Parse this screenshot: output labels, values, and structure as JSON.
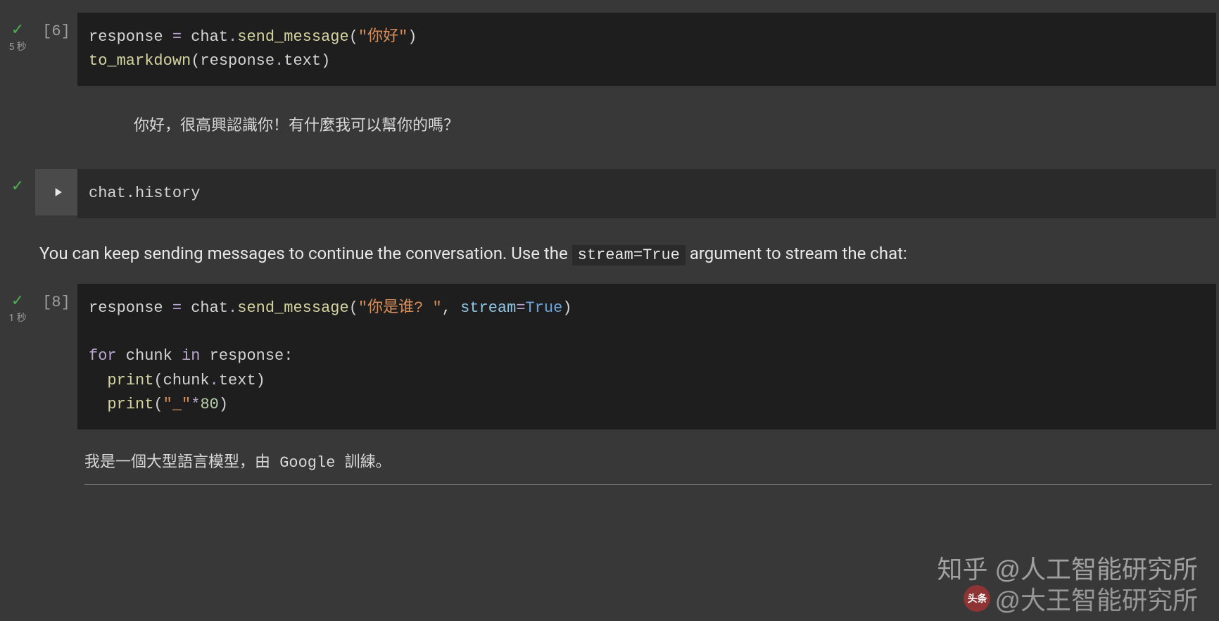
{
  "cells": {
    "c1": {
      "prompt": "[6]",
      "timing": "5 秒",
      "code": {
        "l1a": "response ",
        "l1b": "=",
        "l1c": " chat",
        "l1d": ".",
        "l1e": "send_message",
        "l1f": "(",
        "l1g": "\"你好\"",
        "l1h": ")",
        "l2a": "to_markdown",
        "l2b": "(response",
        "l2c": ".",
        "l2d": "text)"
      },
      "output": "你好，很高興認識你！有什麼我可以幫你的嗎？"
    },
    "c2": {
      "code": "chat.history"
    },
    "text1a": "You can keep sending messages to continue the conversation. Use the ",
    "text1code": "stream=True",
    "text1b": " argument to stream the chat:",
    "c3": {
      "prompt": "[8]",
      "timing": "1 秒",
      "code": {
        "l1a": "response ",
        "l1b": "=",
        "l1c": " chat",
        "l1d": ".",
        "l1e": "send_message",
        "l1f": "(",
        "l1g": "\"你是谁? \"",
        "l1h": ", ",
        "l1i": "stream",
        "l1j": "=",
        "l1k": "True",
        "l1l": ")",
        "l3a": "for",
        "l3b": " chunk ",
        "l3c": "in",
        "l3d": " response:",
        "l4a": "  print",
        "l4b": "(chunk",
        "l4c": ".",
        "l4d": "text)",
        "l5a": "  print",
        "l5b": "(",
        "l5c": "\"_\"",
        "l5d": "*",
        "l5e": "80",
        "l5f": ")"
      },
      "output": "我是一個大型語言模型，由 Google 訓練。"
    }
  },
  "watermarks": {
    "w1": "知乎 @人工智能研究所",
    "w2logo": "头条",
    "w2": "@大王智能研究所"
  }
}
